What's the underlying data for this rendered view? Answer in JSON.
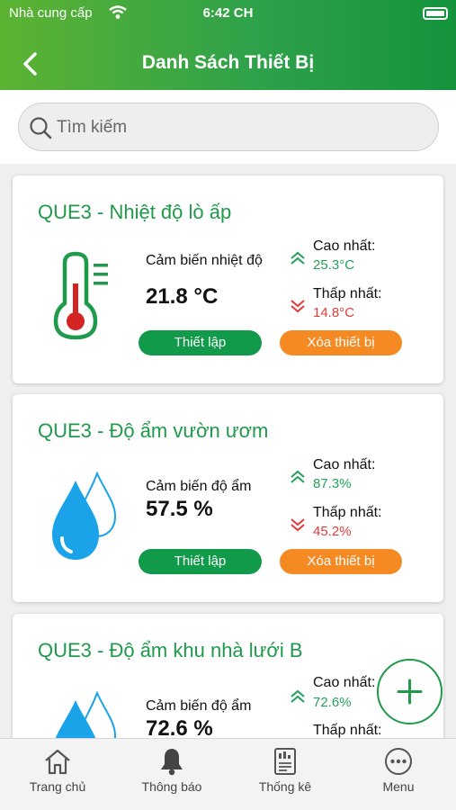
{
  "status_bar": {
    "carrier": "Nhà cung cấp",
    "time": "6:42 CH"
  },
  "header": {
    "title": "Danh Sách Thiết Bị"
  },
  "search": {
    "placeholder": "Tìm kiếm"
  },
  "labels": {
    "high": "Cao nhất:",
    "low": "Thấp nhất:",
    "setup_button": "Thiết lập",
    "delete_button": "Xóa thiết bị"
  },
  "devices": [
    {
      "name": "QUE3 - Nhiệt độ lò ấp",
      "icon": "thermometer-icon",
      "sensor_type": "Cảm biến nhiệt độ",
      "value": "21.8 °C",
      "high": "25.3°C",
      "low": "14.8°C"
    },
    {
      "name": "QUE3 - Độ ẩm vườn ươm",
      "icon": "water-drop-icon",
      "sensor_type": "Cảm biến độ ẩm",
      "value": "57.5 %",
      "high": "87.3%",
      "low": "45.2%"
    },
    {
      "name": "QUE3 - Độ ẩm khu nhà lưới B",
      "icon": "water-drop-icon",
      "sensor_type": "Cảm biến độ ẩm",
      "value": "72.6 %",
      "high": "72.6%",
      "low": ""
    }
  ],
  "tabs": [
    {
      "label": "Trang chủ",
      "icon": "home-icon"
    },
    {
      "label": "Thông báo",
      "icon": "bell-icon"
    },
    {
      "label": "Thống kê",
      "icon": "report-icon"
    },
    {
      "label": "Menu",
      "icon": "more-icon"
    }
  ],
  "colors": {
    "primary_green": "#1f9a4a",
    "header_gradient_start": "#5cb331",
    "header_gradient_end": "#14933c",
    "delete_orange": "#f58a23",
    "high_green": "#25a05a",
    "low_red": "#e23b3b",
    "drop_blue": "#1aa3e8"
  }
}
